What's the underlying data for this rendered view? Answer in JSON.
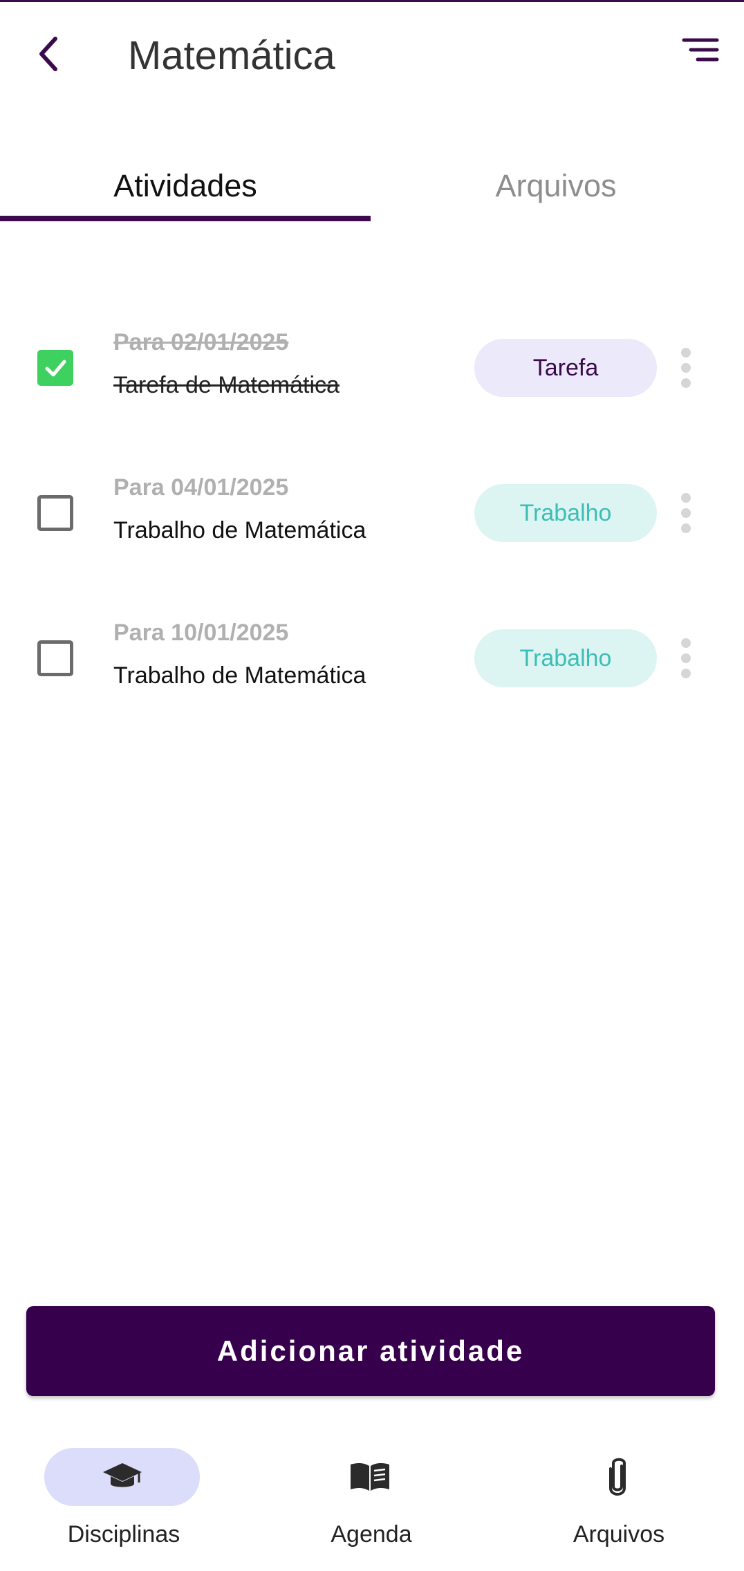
{
  "header": {
    "title": "Matemática",
    "back_icon": "chevron-left-icon",
    "menu_icon": "sort-menu-icon"
  },
  "tabs": [
    {
      "label": "Atividades",
      "active": true
    },
    {
      "label": "Arquivos",
      "active": false
    }
  ],
  "activities": [
    {
      "date": "Para 02/01/2025",
      "name": "Tarefa de Matemática",
      "type": "Tarefa",
      "done": true
    },
    {
      "date": "Para 04/01/2025",
      "name": "Trabalho de Matemática",
      "type": "Trabalho",
      "done": false
    },
    {
      "date": "Para 10/01/2025",
      "name": "Trabalho de Matemática",
      "type": "Trabalho",
      "done": false
    }
  ],
  "add_button": {
    "label": "Adicionar atividade"
  },
  "bottom_nav": [
    {
      "label": "Disciplinas",
      "icon": "graduation-cap-icon",
      "active": true
    },
    {
      "label": "Agenda",
      "icon": "book-open-icon",
      "active": false
    },
    {
      "label": "Arquivos",
      "icon": "paperclip-icon",
      "active": false
    }
  ],
  "colors": {
    "primary": "#37004d",
    "check_green": "#3ed15f",
    "tarefa_badge_bg": "#ece9fb",
    "trabalho_badge_bg": "#ddf5f2",
    "trabalho_text": "#3cbdb5",
    "nav_active_bg": "#dcdcfb"
  }
}
